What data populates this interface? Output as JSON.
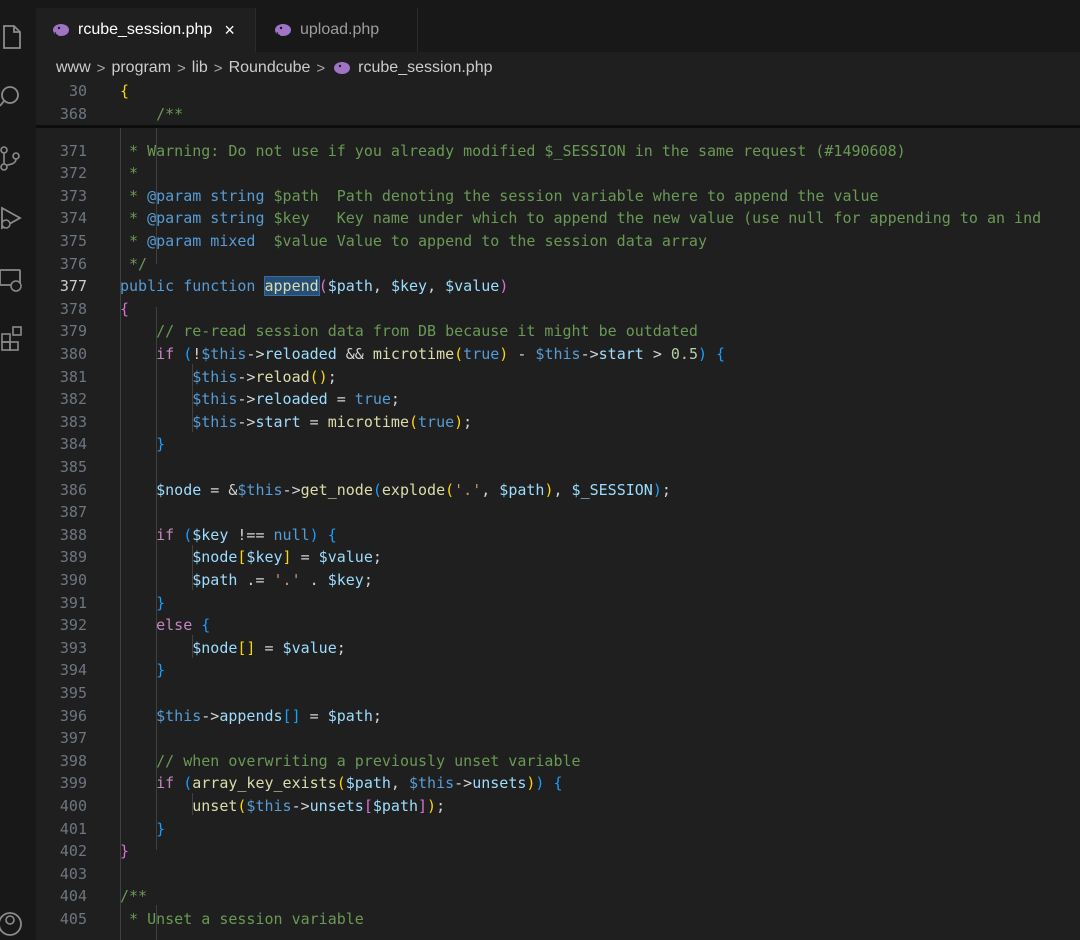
{
  "tabs": [
    {
      "label": "rcube_session.php",
      "active": true,
      "close": "×"
    },
    {
      "label": "upload.php",
      "active": false
    }
  ],
  "breadcrumb": [
    "www",
    "program",
    "lib",
    "Roundcube",
    "rcube_session.php"
  ],
  "breadcrumb_separator": ">",
  "sticky": [
    {
      "num": "30",
      "text": "{"
    },
    {
      "num": "368",
      "text": "/**"
    }
  ],
  "lines": [
    {
      "num": "371",
      "text": "* Warning: Do not use if you already modified $_SESSION in the same request (#1490608)"
    },
    {
      "num": "372",
      "text": "*"
    },
    {
      "num": "373",
      "text": "* @param string $path  Path denoting the session variable where to append the value"
    },
    {
      "num": "374",
      "text": "* @param string $key   Key name under which to append the new value (use null for appending to an ind"
    },
    {
      "num": "375",
      "text": "* @param mixed  $value Value to append to the session data array"
    },
    {
      "num": "376",
      "text": "*/"
    },
    {
      "num": "377",
      "text": "public function append($path, $key, $value)"
    },
    {
      "num": "378",
      "text": "{"
    },
    {
      "num": "379",
      "text": "// re-read session data from DB because it might be outdated"
    },
    {
      "num": "380",
      "text": "if (!$this->reloaded && microtime(true) - $this->start > 0.5) {"
    },
    {
      "num": "381",
      "text": "$this->reload();"
    },
    {
      "num": "382",
      "text": "$this->reloaded = true;"
    },
    {
      "num": "383",
      "text": "$this->start = microtime(true);"
    },
    {
      "num": "384",
      "text": "}"
    },
    {
      "num": "385",
      "text": ""
    },
    {
      "num": "386",
      "text": "$node = &$this->get_node(explode('.', $path), $_SESSION);"
    },
    {
      "num": "387",
      "text": ""
    },
    {
      "num": "388",
      "text": "if ($key !== null) {"
    },
    {
      "num": "389",
      "text": "$node[$key] = $value;"
    },
    {
      "num": "390",
      "text": "$path .= '.' . $key;"
    },
    {
      "num": "391",
      "text": "}"
    },
    {
      "num": "392",
      "text": "else {"
    },
    {
      "num": "393",
      "text": "$node[] = $value;"
    },
    {
      "num": "394",
      "text": "}"
    },
    {
      "num": "395",
      "text": ""
    },
    {
      "num": "396",
      "text": "$this->appends[] = $path;"
    },
    {
      "num": "397",
      "text": ""
    },
    {
      "num": "398",
      "text": "// when overwriting a previously unset variable"
    },
    {
      "num": "399",
      "text": "if (array_key_exists($path, $this->unsets)) {"
    },
    {
      "num": "400",
      "text": "unset($this->unsets[$path]);"
    },
    {
      "num": "401",
      "text": "}"
    },
    {
      "num": "402",
      "text": "}"
    },
    {
      "num": "403",
      "text": ""
    },
    {
      "num": "404",
      "text": "/**"
    },
    {
      "num": "405",
      "text": "* Unset a session variable"
    }
  ],
  "current_line": "377",
  "colors": {
    "editor_bg": "#1f1f1f",
    "comment": "#6a9955",
    "keyword": "#569cd6",
    "function": "#dcdcaa",
    "variable": "#9cdcfe",
    "string": "#ce9178",
    "number": "#b5cea8",
    "selection": "#264f78"
  }
}
